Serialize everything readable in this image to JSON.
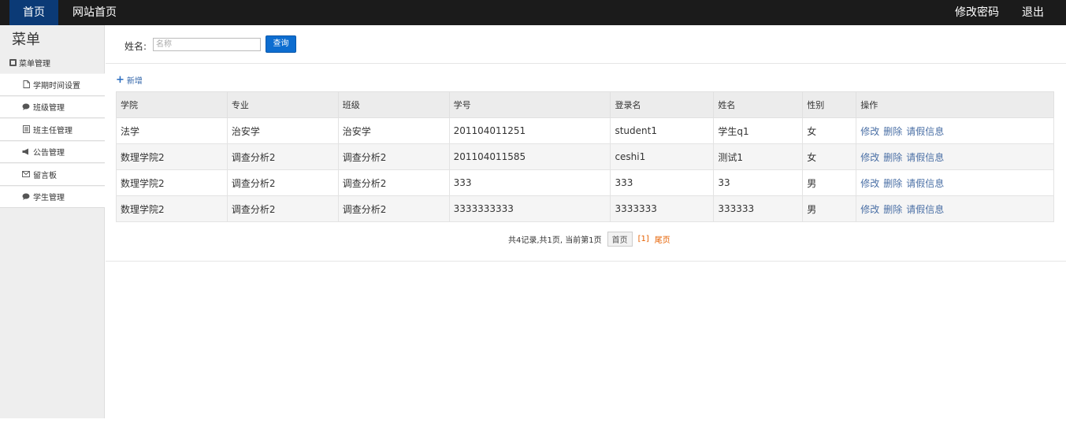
{
  "topnav": {
    "home": "首页",
    "site_home": "网站首页",
    "change_password": "修改密码",
    "logout": "退出"
  },
  "sidebar": {
    "title": "菜单",
    "group": "菜单管理",
    "items": [
      {
        "label": "学期时间设置",
        "icon": "document-icon"
      },
      {
        "label": "班级管理",
        "icon": "chat-bubble-icon"
      },
      {
        "label": "班主任管理",
        "icon": "list-icon"
      },
      {
        "label": "公告管理",
        "icon": "megaphone-icon"
      },
      {
        "label": "留言板",
        "icon": "envelope-icon"
      },
      {
        "label": "学生管理",
        "icon": "chat-bubble-icon"
      }
    ]
  },
  "search": {
    "label": "姓名:",
    "placeholder": "名称",
    "button": "查询"
  },
  "add_label": "新增",
  "table": {
    "headers": [
      "学院",
      "专业",
      "班级",
      "学号",
      "登录名",
      "姓名",
      "性别",
      "操作"
    ],
    "rows": [
      [
        "法学",
        "治安学",
        "治安学",
        "201104011251",
        "student1",
        "学生q1",
        "女"
      ],
      [
        "数理学院2",
        "调查分析2",
        "调查分析2",
        "201104011585",
        "ceshi1",
        "测试1",
        "女"
      ],
      [
        "数理学院2",
        "调查分析2",
        "调查分析2",
        "333",
        "333",
        "33",
        "男"
      ],
      [
        "数理学院2",
        "调查分析2",
        "调查分析2",
        "3333333333",
        "3333333",
        "333333",
        "男"
      ]
    ],
    "actions": [
      "修改",
      "删除",
      "请假信息"
    ]
  },
  "pager": {
    "summary": "共4记录,共1页, 当前第1页",
    "first": "首页",
    "current": "[1]",
    "last": "尾页"
  }
}
